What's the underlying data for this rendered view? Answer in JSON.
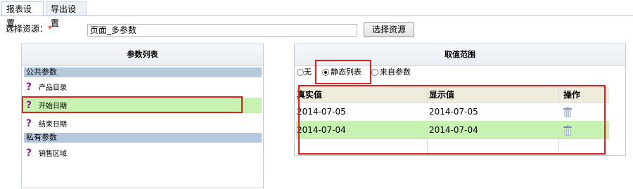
{
  "tabs": [
    {
      "label": "报表设置",
      "active": true
    },
    {
      "label": "导出设置",
      "active": false
    }
  ],
  "resource": {
    "label": "选择资源：",
    "required_mark": "*",
    "value": "页面_多参数",
    "button_label": "选择资源"
  },
  "param_list": {
    "title": "参数列表",
    "public_group": "公共参数",
    "private_group": "私有参数",
    "items": [
      {
        "name": "产品目录",
        "group": "公共参数",
        "selected": false
      },
      {
        "name": "开始日期",
        "group": "公共参数",
        "selected": true
      },
      {
        "name": "结束日期",
        "group": "公共参数",
        "selected": false
      },
      {
        "name": "销售区域",
        "group": "私有参数",
        "selected": false
      }
    ]
  },
  "value_range": {
    "title": "取值范围",
    "options": [
      {
        "label": "无",
        "checked": false
      },
      {
        "label": "静态列表",
        "checked": true
      },
      {
        "label": "来自参数",
        "checked": false
      }
    ],
    "columns": {
      "real": "真实值",
      "display": "显示值",
      "action": "操作"
    },
    "rows": [
      {
        "real": "2014-07-05",
        "display": "2014-07-05",
        "selected": false
      },
      {
        "real": "2014-07-04",
        "display": "2014-07-04",
        "selected": true
      }
    ]
  },
  "colors": {
    "highlight": "#e02020",
    "selected_row": "#c8f2b2",
    "group_header": "#b5c8dc",
    "question_icon": "#8a1e8a"
  },
  "icons": [
    "question-icon",
    "trash-icon",
    "radio-icon"
  ]
}
